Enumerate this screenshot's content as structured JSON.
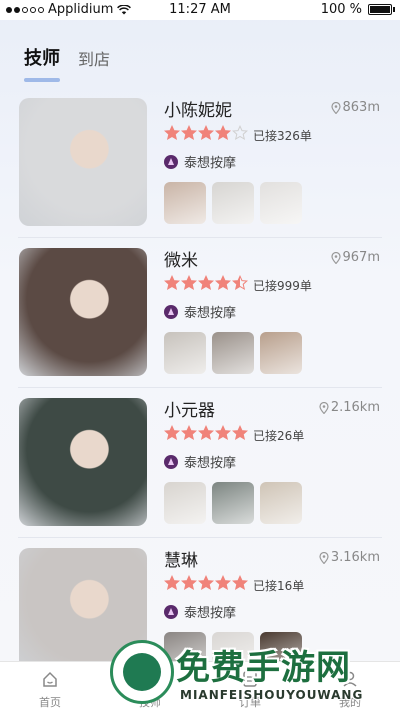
{
  "status_bar": {
    "carrier": "Applidium",
    "time": "11:27 AM",
    "battery": "100 %"
  },
  "tabs": [
    {
      "label": "技师",
      "active": true
    },
    {
      "label": "到店",
      "active": false
    }
  ],
  "therapists": [
    {
      "name": "小陈妮妮",
      "distance": "863m",
      "rating": 4,
      "orders": "已接326单",
      "shop": "泰想按摩",
      "photo_color": "#d9dadc",
      "thumb_colors": [
        "#c9b4a6",
        "#d7d5d2",
        "#e2e0de"
      ]
    },
    {
      "name": "微米",
      "distance": "967m",
      "rating": 4.5,
      "orders": "已接999单",
      "shop": "泰想按摩",
      "photo_color": "#5b4a44",
      "thumb_colors": [
        "#c7c2bc",
        "#9a918a",
        "#b89f8c"
      ]
    },
    {
      "name": "小元器",
      "distance": "2.16km",
      "rating": 5,
      "orders": "已接26单",
      "shop": "泰想按摩",
      "photo_color": "#3e4a45",
      "thumb_colors": [
        "#d8d4cf",
        "#7c8581",
        "#cfc4b6"
      ]
    },
    {
      "name": "慧琳",
      "distance": "3.16km",
      "rating": 5,
      "orders": "已接16单",
      "shop": "泰想按摩",
      "photo_color": "#c9c5c3",
      "thumb_colors": [
        "#8a8582",
        "#d9d6d3",
        "#4a3a30"
      ]
    }
  ],
  "bottom_nav": [
    {
      "label": "首页",
      "icon": "home-icon"
    },
    {
      "label": "技师",
      "icon": "therapist-icon"
    },
    {
      "label": "订单",
      "icon": "order-icon"
    },
    {
      "label": "我的",
      "icon": "profile-icon"
    }
  ],
  "watermark": {
    "title": "免费手游网",
    "subtitle": "MIANFEISHOUYOUWANG"
  },
  "colors": {
    "star": "#f0837a",
    "star_empty": "#d0d0d0",
    "tab_underline": "#9fb9e8",
    "watermark": "#1d6f3f"
  }
}
